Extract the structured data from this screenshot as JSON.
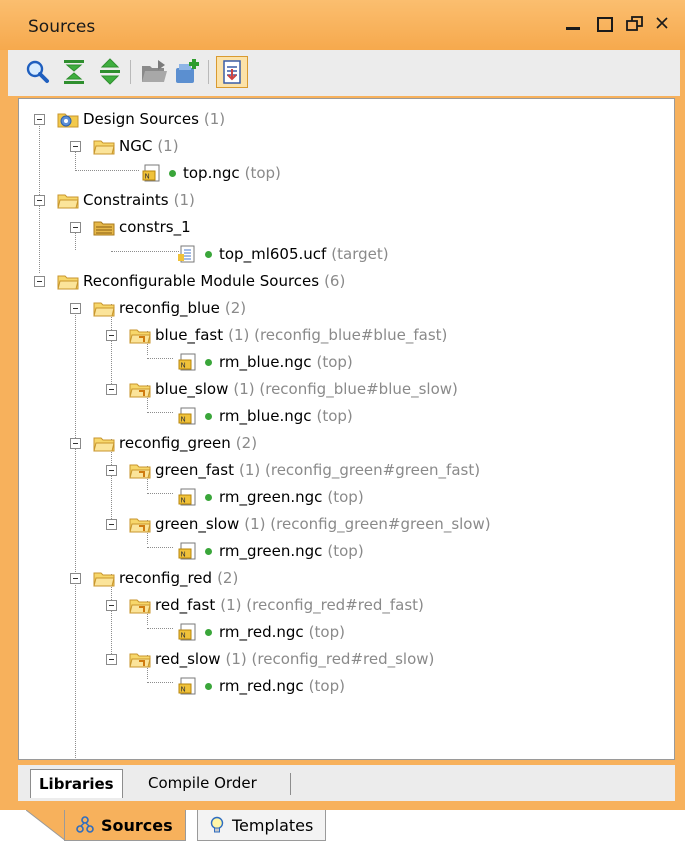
{
  "panel": {
    "title": "Sources"
  },
  "window_controls": [
    "minimize-icon",
    "maximize-icon",
    "restore-icon",
    "close-icon"
  ],
  "toolbar": {
    "buttons": [
      "search-icon",
      "collapse-all-icon",
      "expand-all-icon",
      "open-folder-icon",
      "add-sources-icon",
      "auto-scroll-icon"
    ]
  },
  "tree": [
    {
      "label": "Design Sources",
      "meta": "(1)",
      "icon": "design-sources-folder-icon"
    },
    {
      "label": "NGC",
      "meta": "(1)",
      "icon": "folder-icon"
    },
    {
      "label": "top.ngc",
      "meta": "(top)",
      "icon": "ngc-file-icon"
    },
    {
      "label": "Constraints",
      "meta": "(1)",
      "icon": "folder-icon"
    },
    {
      "label": "constrs_1",
      "meta": "",
      "icon": "constraint-set-icon"
    },
    {
      "label": "top_ml605.ucf",
      "meta": "(target)",
      "icon": "ucf-file-icon"
    },
    {
      "label": "Reconfigurable Module Sources",
      "meta": "(6)",
      "icon": "folder-icon"
    },
    {
      "label": "reconfig_blue",
      "meta": "(2)",
      "icon": "folder-icon"
    },
    {
      "label": "blue_fast",
      "meta": "(1) (reconfig_blue#blue_fast)",
      "icon": "module-folder-icon"
    },
    {
      "label": "rm_blue.ngc",
      "meta": "(top)",
      "icon": "ngc-file-icon"
    },
    {
      "label": "blue_slow",
      "meta": "(1) (reconfig_blue#blue_slow)",
      "icon": "module-folder-icon"
    },
    {
      "label": "rm_blue.ngc",
      "meta": "(top)",
      "icon": "ngc-file-icon"
    },
    {
      "label": "reconfig_green",
      "meta": "(2)",
      "icon": "folder-icon"
    },
    {
      "label": "green_fast",
      "meta": "(1) (reconfig_green#green_fast)",
      "icon": "module-folder-icon"
    },
    {
      "label": "rm_green.ngc",
      "meta": "(top)",
      "icon": "ngc-file-icon"
    },
    {
      "label": "green_slow",
      "meta": "(1) (reconfig_green#green_slow)",
      "icon": "module-folder-icon"
    },
    {
      "label": "rm_green.ngc",
      "meta": "(top)",
      "icon": "ngc-file-icon"
    },
    {
      "label": "reconfig_red",
      "meta": "(2)",
      "icon": "folder-icon"
    },
    {
      "label": "red_fast",
      "meta": "(1) (reconfig_red#red_fast)",
      "icon": "module-folder-icon"
    },
    {
      "label": "rm_red.ngc",
      "meta": "(top)",
      "icon": "ngc-file-icon"
    },
    {
      "label": "red_slow",
      "meta": "(1) (reconfig_red#red_slow)",
      "icon": "module-folder-icon"
    },
    {
      "label": "rm_red.ngc",
      "meta": "(top)",
      "icon": "ngc-file-icon"
    }
  ],
  "inner_tabs": {
    "libraries": "Libraries",
    "compile_order": "Compile Order"
  },
  "bottom_tabs": {
    "sources": "Sources",
    "templates": "Templates"
  },
  "colors": {
    "panel_header": "#f7b15c",
    "status_ok": "#3aa63a",
    "meta_text": "#8a8a8a"
  }
}
